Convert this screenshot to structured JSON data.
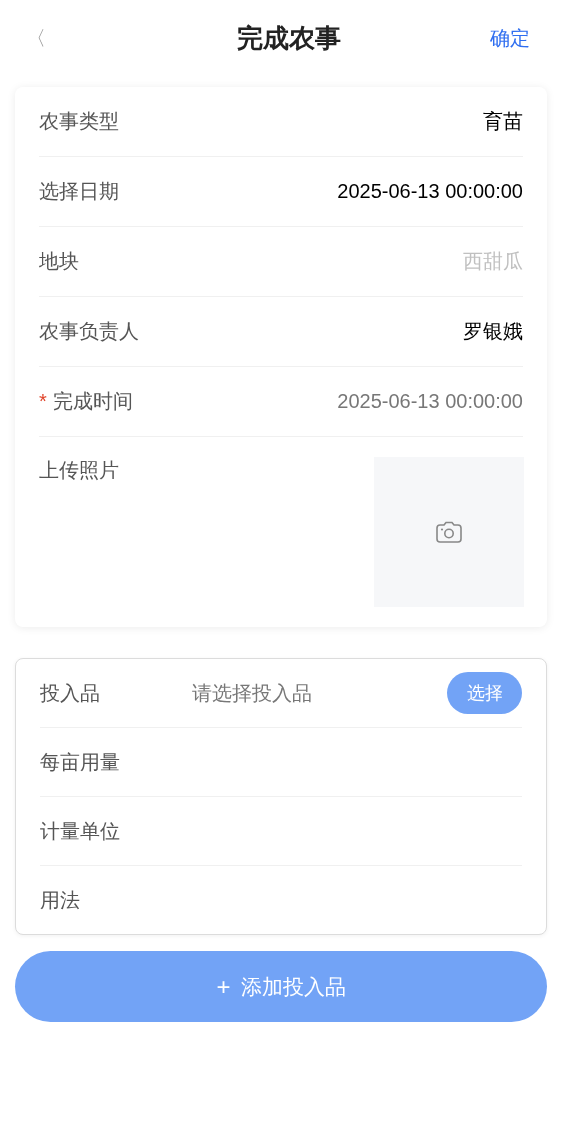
{
  "header": {
    "back_icon": "〈",
    "title": "完成农事",
    "confirm": "确定"
  },
  "details": [
    {
      "kind": "text",
      "label": "农事类型",
      "value": "育苗"
    },
    {
      "kind": "text",
      "label": "选择日期",
      "value": "2025-06-13 00:00:00"
    },
    {
      "kind": "disabled",
      "label": "地块",
      "value": "西甜瓜"
    },
    {
      "kind": "text",
      "label": "农事负责人",
      "value": "罗银娥"
    },
    {
      "kind": "picker",
      "label": "完成时间",
      "value": "2025-06-13 00:00:00",
      "required_mark": "*"
    },
    {
      "kind": "upload",
      "label": "上传照片"
    }
  ],
  "inputs": [
    {
      "kind": "select",
      "label": "投入品",
      "placeholder": "请选择投入品",
      "button": "选择"
    },
    {
      "kind": "field",
      "label": "每亩用量"
    },
    {
      "kind": "field",
      "label": "计量单位"
    },
    {
      "kind": "field",
      "label": "用法"
    }
  ],
  "add_button": {
    "icon": "+",
    "label": "添加投入品"
  }
}
